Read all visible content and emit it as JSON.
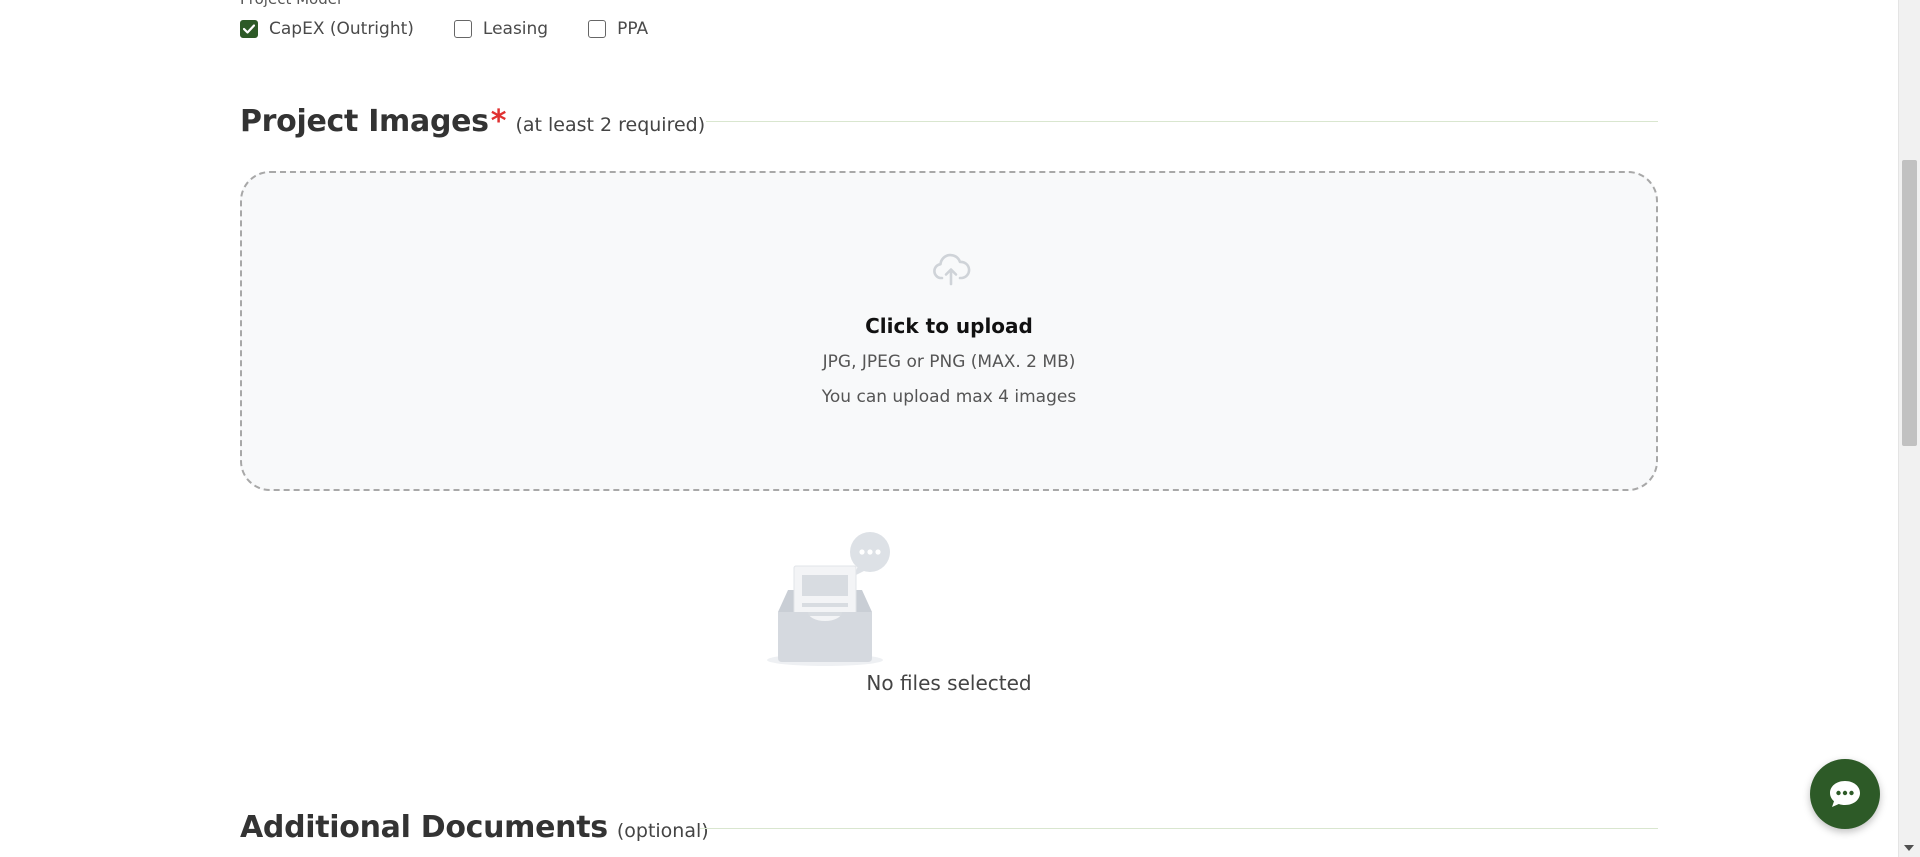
{
  "project_model": {
    "label": "Project Model",
    "options": [
      {
        "label": "CapEX (Outright)",
        "checked": true
      },
      {
        "label": "Leasing",
        "checked": false
      },
      {
        "label": "PPA",
        "checked": false
      }
    ]
  },
  "project_images": {
    "title": "Project Images",
    "required_marker": "*",
    "note": "(at least 2 required)",
    "upload": {
      "icon": "cloud-upload-icon",
      "title": "Click to upload",
      "formats": "JPG, JPEG or PNG (MAX. 2 MB)",
      "limit": "You can upload max 4 images"
    },
    "empty_state": {
      "icon": "empty-inbox-illustration",
      "text": "No files selected"
    }
  },
  "additional_documents": {
    "title": "Additional Documents",
    "note": "(optional)"
  },
  "chat": {
    "icon": "chat-bubble-icon"
  },
  "colors": {
    "brand_green": "#2d5a27",
    "required_red": "#e03131",
    "dropzone_background": "#f8f9fa",
    "dropzone_border": "#a8a8a8",
    "divider": "#d9e6cf"
  }
}
